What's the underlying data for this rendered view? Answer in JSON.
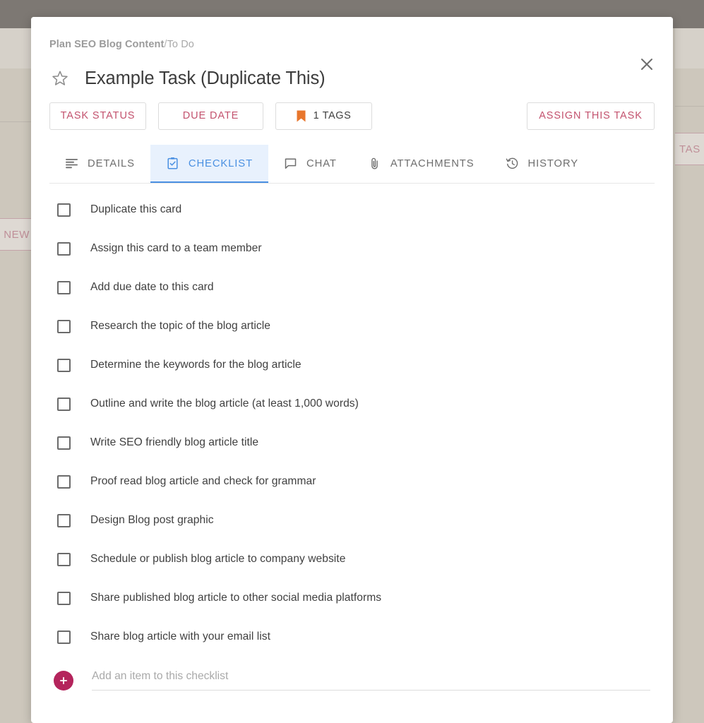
{
  "modal": {
    "breadcrumb": {
      "board": "Plan SEO Blog Content",
      "separator": "/",
      "list": "To Do"
    },
    "title": "Example Task (Duplicate This)",
    "close_label": "✕",
    "actions": {
      "task_status": "TASK STATUS",
      "due_date": "DUE DATE",
      "tags": "1 TAGS",
      "assign": "ASSIGN THIS TASK"
    },
    "tabs": [
      {
        "label": "DETAILS",
        "icon": "subject-icon",
        "active": false
      },
      {
        "label": "CHECKLIST",
        "icon": "checklist-icon",
        "active": true
      },
      {
        "label": "CHAT",
        "icon": "chat-bubble-icon",
        "active": false
      },
      {
        "label": "ATTACHMENTS",
        "icon": "paperclip-icon",
        "active": false
      },
      {
        "label": "HISTORY",
        "icon": "history-icon",
        "active": false
      }
    ],
    "checklist": {
      "items": [
        {
          "label": "Duplicate this card",
          "checked": false
        },
        {
          "label": "Assign this card to a team member",
          "checked": false
        },
        {
          "label": "Add due date to this card",
          "checked": false
        },
        {
          "label": "Research the topic of the blog article",
          "checked": false
        },
        {
          "label": "Determine the keywords for the blog article",
          "checked": false
        },
        {
          "label": "Outline and write the blog article (at least 1,000 words)",
          "checked": false
        },
        {
          "label": "Write SEO friendly blog article title",
          "checked": false
        },
        {
          "label": "Proof read blog article and check for grammar",
          "checked": false
        },
        {
          "label": "Design Blog post graphic",
          "checked": false
        },
        {
          "label": "Schedule or publish blog article to company website",
          "checked": false
        },
        {
          "label": "Share published blog article to other social media platforms",
          "checked": false
        },
        {
          "label": "Share blog article with your email list",
          "checked": false
        }
      ],
      "add_placeholder": "Add an item to this checklist",
      "add_value": "",
      "add_button_label": "+"
    }
  },
  "background": {
    "left_button_label": "NEW",
    "right_button_label": "TAS"
  },
  "colors": {
    "accent_pink": "#c3526e",
    "add_button": "#b4245c",
    "tab_active": "#4a90e2",
    "tab_active_bg": "#e8f1fd",
    "tag_icon": "#e8762c",
    "text_primary": "#3f3f3f",
    "text_muted": "#9b9b9b",
    "overlay_top": "#7d7873",
    "overlay_body": "#cdc7bc"
  }
}
